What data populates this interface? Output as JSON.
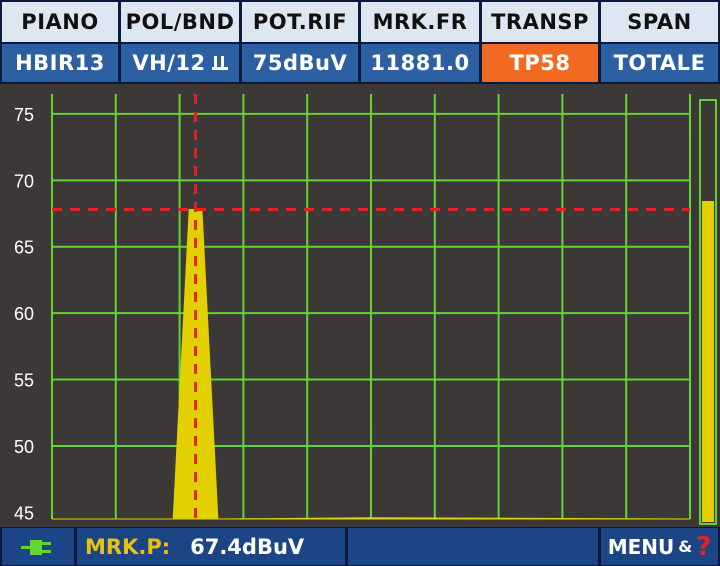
{
  "header": {
    "labels": [
      "PIANO",
      "POL/BND",
      "POT.RIF",
      "MRK.FR",
      "TRANSP",
      "SPAN"
    ],
    "values": [
      "HBIR13",
      "VH/12",
      "75dBuV",
      "11881.0",
      "TP58",
      "TOTALE"
    ],
    "highlight_color": "#f26a21"
  },
  "chart_data": {
    "type": "area",
    "y_ticks": [
      75,
      70,
      65,
      60,
      55,
      50,
      45
    ],
    "ylim": [
      44.5,
      76.5
    ],
    "x": [
      0,
      0.19,
      0.215,
      0.235,
      0.26,
      0.5,
      1
    ],
    "y": [
      44.5,
      44.5,
      67.8,
      67.8,
      44.5,
      44.6,
      44.5
    ],
    "marker": {
      "x": 0.225,
      "level": 67.8
    },
    "meter_level": 0.76,
    "colors": {
      "grid": "#5fd631",
      "trace": "#e2d000",
      "marker": "#e32222",
      "background": "#3c3838"
    }
  },
  "footer": {
    "marker_label": "MRK.P:",
    "marker_value": "67.4dBuV",
    "menu_label": "MENU",
    "menu_amp": "&",
    "menu_help": "?",
    "plug_icon": "power-plug-icon"
  }
}
